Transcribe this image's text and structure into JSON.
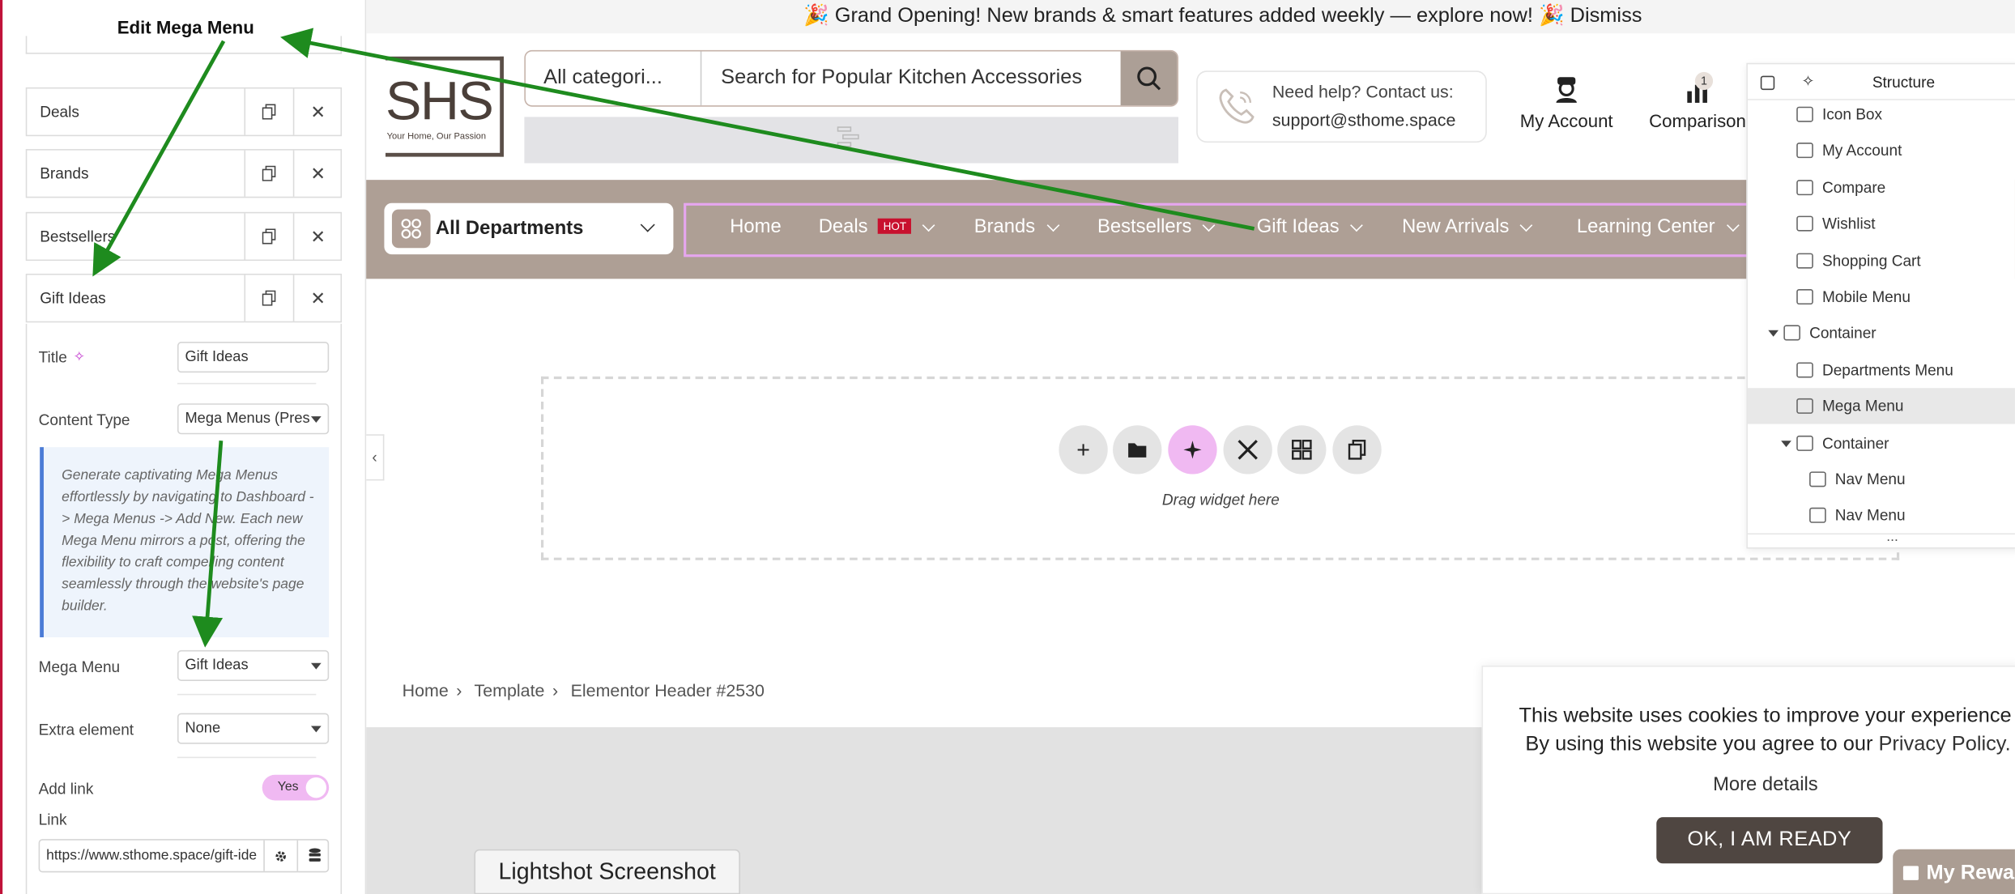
{
  "editor": {
    "title": "Edit Mega Menu",
    "items": [
      {
        "label": "Deals"
      },
      {
        "label": "Brands"
      },
      {
        "label": "Bestsellers"
      },
      {
        "label": "Gift Ideas"
      }
    ],
    "fields": {
      "title_label": "Title",
      "title_value": "Gift Ideas",
      "content_type_label": "Content Type",
      "content_type_value": "Mega Menus (Pres",
      "note": "Generate captivating Mega Menus effortlessly by navigating to Dashboard -> Mega Menus -> Add New. Each new Mega Menu mirrors a post, offering the flexibility to craft compelling content seamlessly through the website's page builder.",
      "mega_menu_label": "Mega Menu",
      "mega_menu_value": "Gift Ideas",
      "extra_label": "Extra element",
      "extra_value": "None",
      "add_link_label": "Add link",
      "add_link_value": "Yes",
      "link_label": "Link",
      "link_value": "https://www.sthome.space/gift-ide"
    }
  },
  "site": {
    "announcement": "🎉 Grand Opening! New brands & smart features added weekly — explore now! 🎉 Dismiss",
    "logo_text": "SHS",
    "logo_tagline": "Your Home, Our Passion",
    "search_category": "All categori...",
    "search_query": "Search for Popular Kitchen Accessories",
    "help_line1": "Need help? Contact us:",
    "help_line2": "support@sthome.space",
    "account_label": "My Account",
    "comparison_label": "Comparison",
    "comparison_count": "1",
    "departments": "All Departments",
    "nav": [
      "Home",
      "Deals",
      "Brands",
      "Bestsellers",
      "Gift Ideas",
      "New Arrivals",
      "Learning Center"
    ],
    "hot_badge": "HOT",
    "drag_text": "Drag widget here",
    "breadcrumb": [
      "Home",
      "Template",
      "Elementor Header #2530"
    ],
    "lightshot": "Lightshot Screenshot",
    "cookie_text1": "This website uses cookies to improve your experience",
    "cookie_text2_prefix": "By using this website you agree to our",
    "cookie_link": "Privacy Policy.",
    "cookie_more": "More details",
    "cookie_ok": "OK, I AM READY",
    "rewards": "My Rewa",
    "accent": "#ae9f95"
  },
  "structure": {
    "title": "Structure",
    "items": [
      "Icon Box",
      "My Account",
      "Compare",
      "Wishlist",
      "Shopping Cart",
      "Mobile Menu",
      "Container",
      "Departments Menu",
      "Mega Menu",
      "Container",
      "Nav Menu",
      "Nav Menu"
    ],
    "more": "..."
  }
}
